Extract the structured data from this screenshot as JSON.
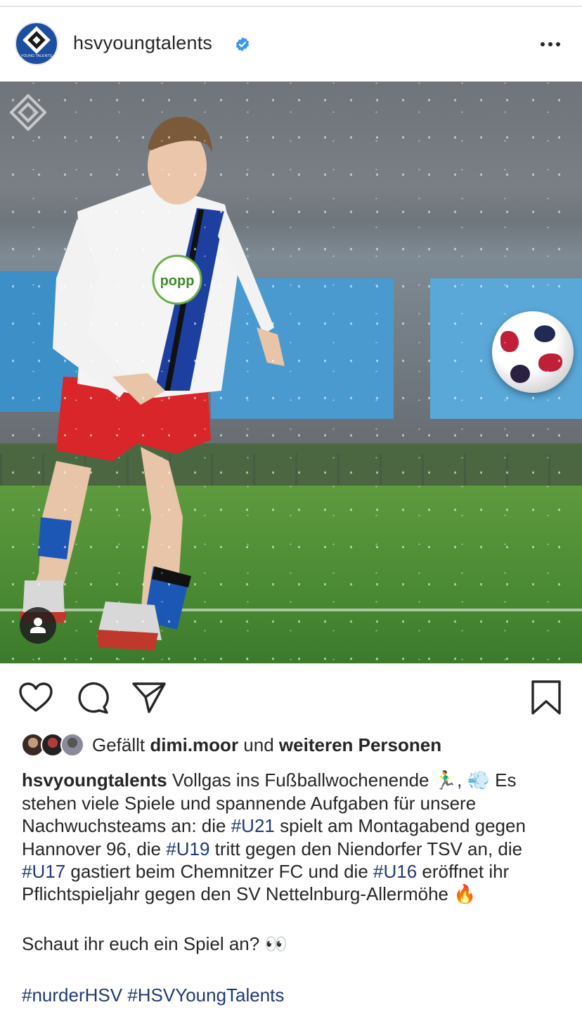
{
  "header": {
    "username": "hsvyoungtalents",
    "avatar_text": "YOUNG TALENTS",
    "verified_icon": "verified-badge-icon",
    "more_icon": "more-options-icon"
  },
  "photo": {
    "icons": [
      "hsv-diamond-watermark-icon",
      "user-tag-icon"
    ]
  },
  "actions": {
    "icons": [
      "heart-icon",
      "comment-icon",
      "share-icon",
      "bookmark-icon"
    ]
  },
  "likes": {
    "prefix": "Gefällt",
    "user": "dimi.moor",
    "middle": "und",
    "suffix": "weiteren Personen"
  },
  "caption": {
    "author": "hsvyoungtalents",
    "line1_text": " Vollgas ins Fußballwochenende ",
    "emoji_run": "🏃‍♂️",
    "comma": ", ",
    "emoji_dash": "💨",
    "text2": " Es stehen viele Spiele und spannende Aufgaben für unsere Nachwuchsteams an: die ",
    "tag_u21": "#U21",
    "text3": " spielt am Montagabend gegen Hannover 96, die ",
    "tag_u19": "#U19",
    "text4": " tritt gegen den Niendorfer TSV an, die ",
    "tag_u17": "#U17",
    "text5": " gastiert beim Chemnitzer FC und die ",
    "tag_u16": "#U16",
    "text6": " eröffnet ihr Pflichtspieljahr gegen den SV Nettelnburg-Allermöhe ",
    "emoji_fire": "🔥",
    "question": "Schaut ihr euch ein Spiel an? ",
    "emoji_eyes": "👀",
    "tag_nurderhsv": "#nurderHSV",
    "tag_hsvyoungtalents": "#HSVYoungTalents"
  },
  "colors": {
    "hashtag": "#1f3a73",
    "text": "#262626",
    "verified": "#3897f0",
    "avatar_bg": "#1c4fa0"
  }
}
